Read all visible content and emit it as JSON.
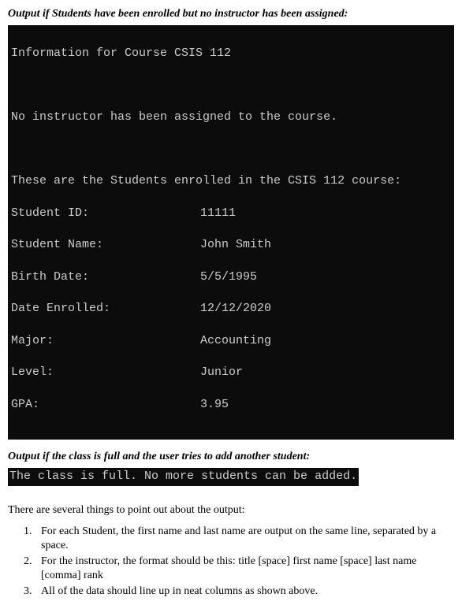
{
  "caption1": "Output if Students have been enrolled but no instructor has been assigned:",
  "terminal1": {
    "title": "Information for Course CSIS 112",
    "noInstructor": "No instructor has been assigned to the course.",
    "enrolledHeader": "These are the Students enrolled in the CSIS 112 course:",
    "fields": [
      {
        "label": "Student ID:",
        "value": "11111"
      },
      {
        "label": "Student Name:",
        "value": "John Smith"
      },
      {
        "label": "Birth Date:",
        "value": "5/5/1995"
      },
      {
        "label": "Date Enrolled:",
        "value": "12/12/2020"
      },
      {
        "label": "Major:",
        "value": "Accounting"
      },
      {
        "label": "Level:",
        "value": "Junior"
      },
      {
        "label": "GPA:",
        "value": "3.95"
      }
    ]
  },
  "caption2": "Output if the class is full and the user tries to add another student:",
  "terminal2": {
    "line": "The class is full. No more students can be added."
  },
  "notesIntro": "There are several things to point out about the output:",
  "notes": [
    "For each Student, the first name and last name are output on the same line, separated by a space.",
    "For the instructor, the format should be this:   title [space] first name [space] last name [comma] rank",
    "All of the data should line up in neat columns as shown above."
  ]
}
